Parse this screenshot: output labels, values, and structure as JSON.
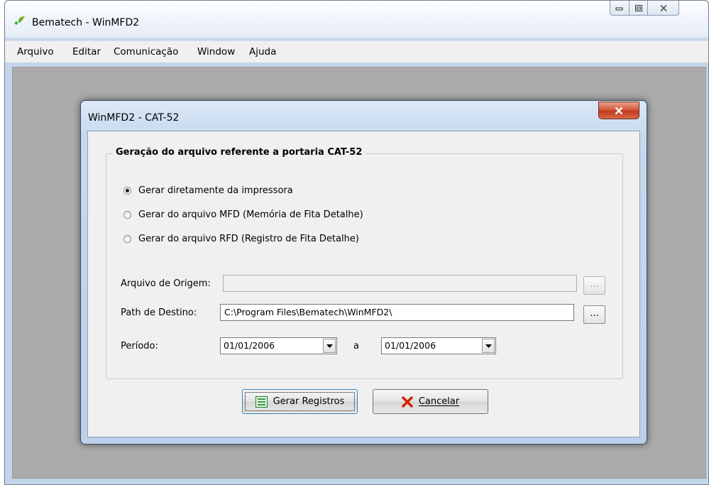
{
  "window": {
    "title": "Bematech - WinMFD2"
  },
  "menu": {
    "items": [
      "Arquivo",
      "Editar",
      "Comunicação",
      "Window",
      "Ajuda"
    ]
  },
  "dialog": {
    "title": "WinMFD2 - CAT-52",
    "group_title": "Geração do arquivo referente a portaria CAT-52",
    "options": [
      {
        "label": "Gerar diretamente da impressora",
        "selected": true
      },
      {
        "label": "Gerar do arquivo MFD (Memória de Fita Detalhe)",
        "selected": false
      },
      {
        "label": "Gerar do arquivo RFD (Registro de Fita Detalhe)",
        "selected": false
      }
    ],
    "origin": {
      "label": "Arquivo de Origem:",
      "value": "",
      "browse": "..."
    },
    "destination": {
      "label": "Path de Destino:",
      "value": "C:\\Program Files\\Bematech\\WinMFD2\\",
      "browse": "..."
    },
    "period": {
      "label": "Período:",
      "start": "01/01/2006",
      "separator": "a",
      "end": "01/01/2006"
    },
    "buttons": {
      "generate": "Gerar Registros",
      "cancel": "Cancelar"
    }
  },
  "colors": {
    "mdi_background": "#ababab",
    "dialog_close": "#c7432a",
    "cancel_icon": "#d81e05",
    "logo_green": "#3fae29",
    "logo_orange": "#f39c12"
  }
}
